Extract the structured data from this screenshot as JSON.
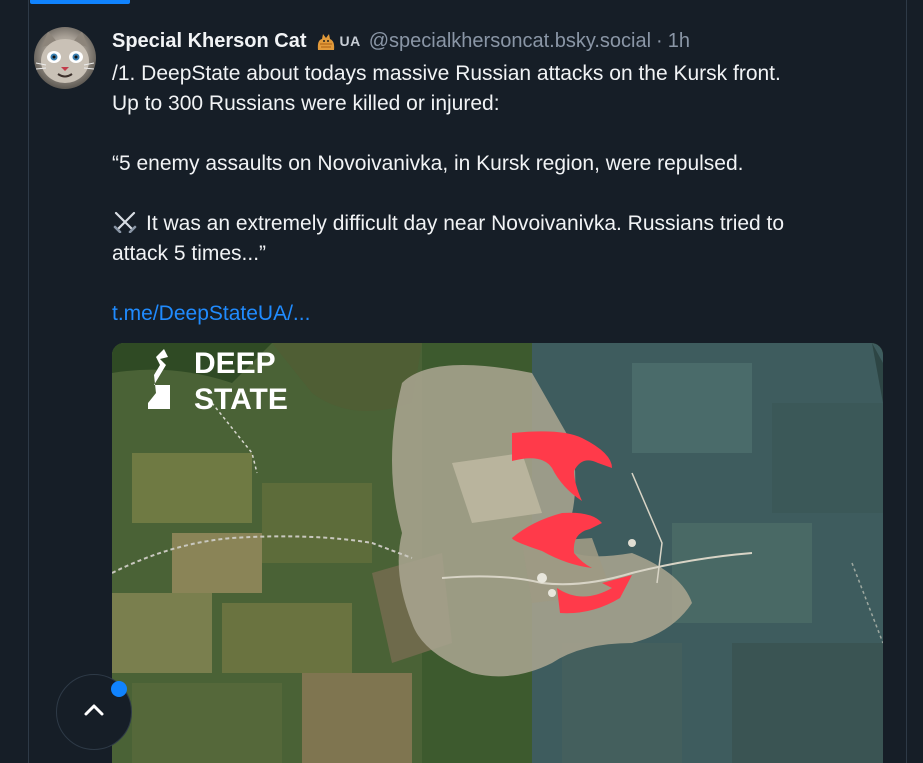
{
  "post": {
    "author": "Special Kherson Cat",
    "badge": "UA",
    "handle": "@specialkhersoncat.bsky.social",
    "separator": "·",
    "time": "1h",
    "lines": [
      "/1. DeepState about todays massive Russian attacks on the Kursk front.",
      "Up to 300 Russians were killed or injured:"
    ],
    "quote_line": "“5 enemy assaults on Novoivanivka, in Kursk region, were repulsed.",
    "emoji_line_1": "It was an extremely difficult day near Novoivanivka. Russians tried to",
    "emoji_line_2": "attack 5 times...”",
    "link": "t.me/DeepStateUA/..."
  },
  "image": {
    "logo_line_1": "DEEP",
    "logo_line_2": "STATE"
  },
  "icons": {
    "avatar": "cat-avatar",
    "badge_emoji": "cat-emoji-icon",
    "swords": "crossed-swords-icon",
    "scroll_top": "chevron-up-icon"
  },
  "colors": {
    "background": "#161e27",
    "link": "#208bfe",
    "accent": "#1083fe",
    "attack_arrows": "#ff3a4a"
  }
}
